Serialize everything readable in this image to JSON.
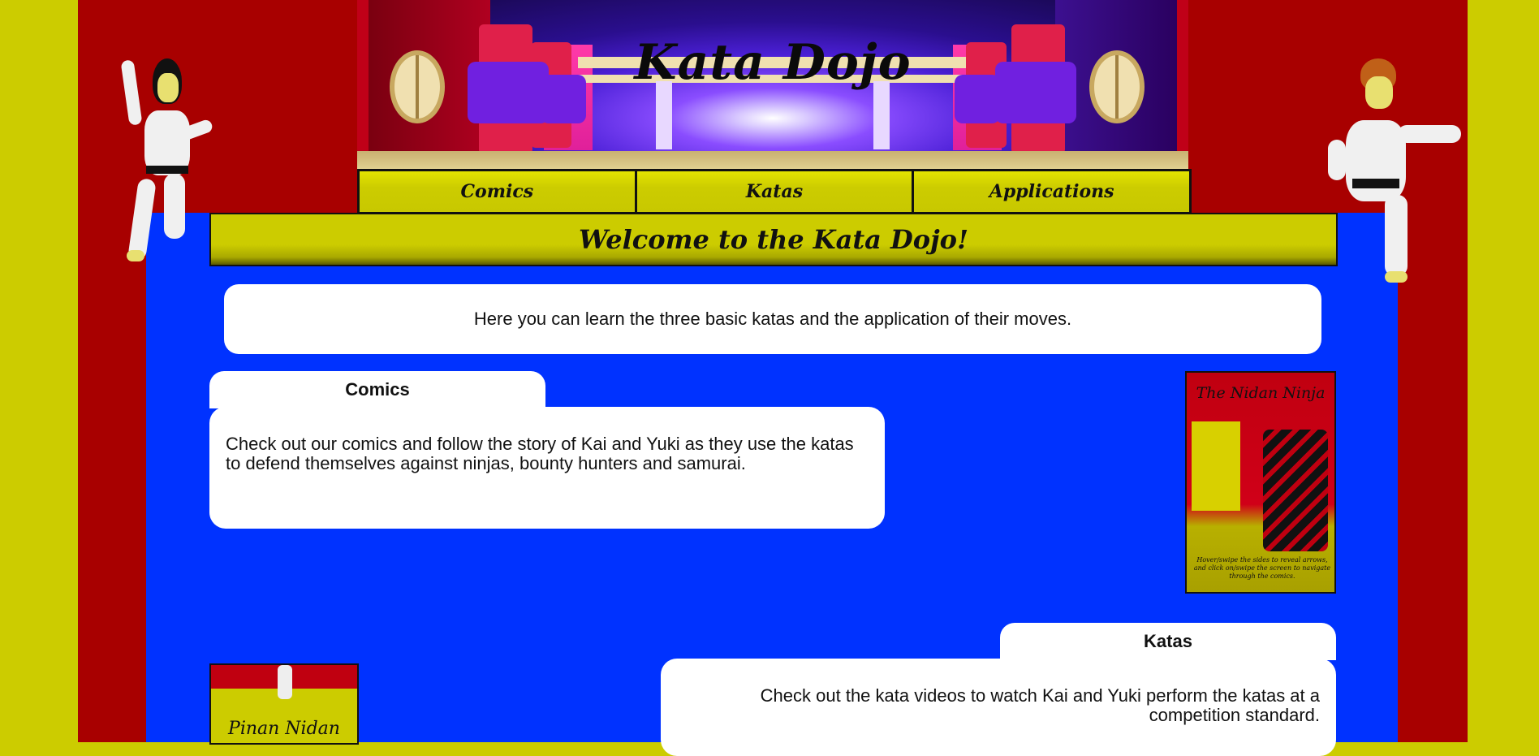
{
  "banner": {
    "title": "Kata Dojo"
  },
  "nav": {
    "items": [
      {
        "label": "Comics"
      },
      {
        "label": "Katas"
      },
      {
        "label": "Applications"
      }
    ]
  },
  "welcome": {
    "heading": "Welcome to the Kata Dojo!"
  },
  "intro": {
    "text": "Here you can learn the three basic katas and the application of their moves."
  },
  "sections": {
    "comics": {
      "tab_label": "Comics",
      "text": "Check out our comics and follow the story of Kai and Yuki as they use the katas to defend themselves against ninjas, bounty hunters and samurai.",
      "thumb_title": "The Nidan Ninja",
      "thumb_caption": "Hover/swipe the sides to reveal arrows, and click on/swipe the screen to navigate through the comics."
    },
    "katas": {
      "tab_label": "Katas",
      "text": "Check out the kata videos to watch Kai and Yuki perform the katas at a competition standard.",
      "thumb_title": "Pinan Nidan"
    }
  },
  "colors": {
    "page_bg": "#cccc00",
    "red_bg": "#a80000",
    "panel_blue": "#0032ff",
    "nav_yellow": "#cccc00"
  }
}
